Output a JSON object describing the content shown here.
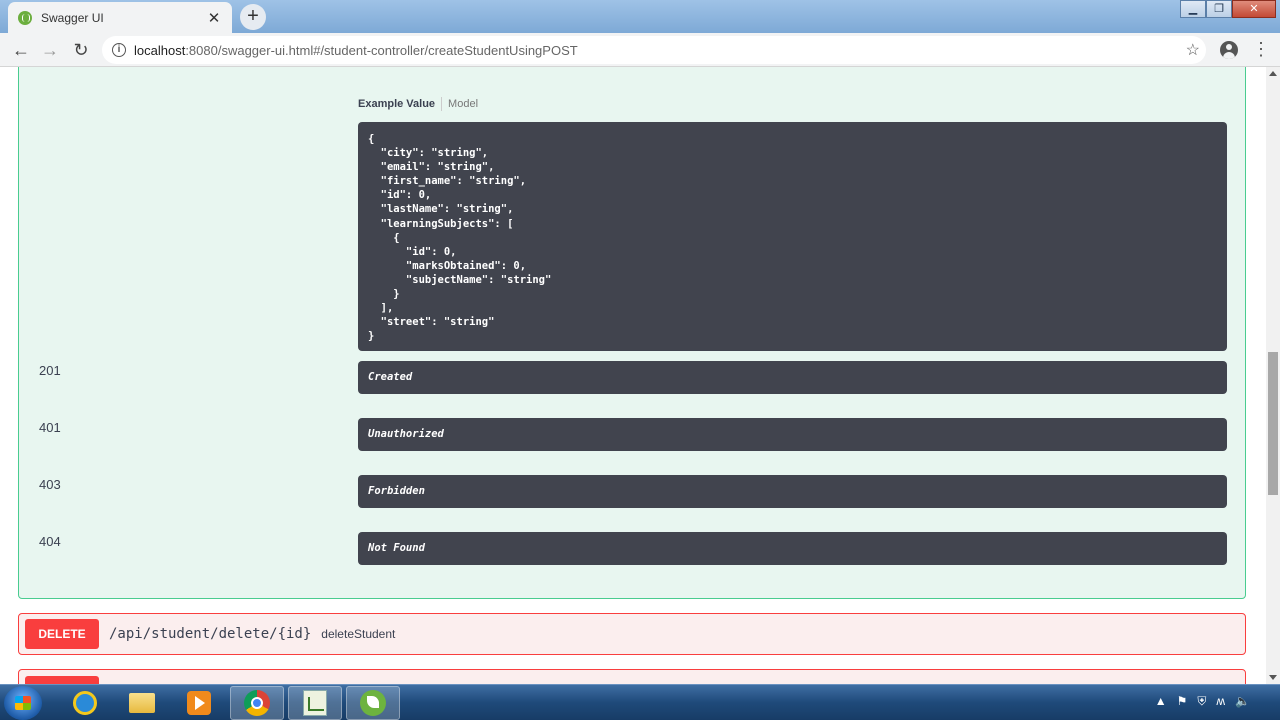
{
  "browser": {
    "tab_title": "Swagger UI",
    "tab_close": "✕",
    "new_tab": "+",
    "url_host": "localhost",
    "url_rest": ":8080/swagger-ui.html#/student-controller/createStudentUsingPOST",
    "nav": {
      "back": "←",
      "forward": "→",
      "reload": "↻",
      "star": "☆",
      "menu": "⋮"
    },
    "window_controls": {
      "minimize": "▁",
      "maximize": "❐",
      "close": "✕"
    }
  },
  "swagger": {
    "example_tab": "Example Value",
    "model_tab": "Model",
    "example_json": "{\n  \"city\": \"string\",\n  \"email\": \"string\",\n  \"first_name\": \"string\",\n  \"id\": 0,\n  \"lastName\": \"string\",\n  \"learningSubjects\": [\n    {\n      \"id\": 0,\n      \"marksObtained\": 0,\n      \"subjectName\": \"string\"\n    }\n  ],\n  \"street\": \"string\"\n}",
    "responses": [
      {
        "code": "201",
        "description": "Created"
      },
      {
        "code": "401",
        "description": "Unauthorized"
      },
      {
        "code": "403",
        "description": "Forbidden"
      },
      {
        "code": "404",
        "description": "Not Found"
      }
    ],
    "delete_operation": {
      "method": "DELETE",
      "path": "/api/student/delete/{id}",
      "summary": "deleteStudent"
    }
  },
  "taskbar": {
    "items": [
      "start-button",
      "internet-explorer",
      "file-explorer",
      "media-player",
      "chrome",
      "chart-app",
      "spring-tool-suite"
    ],
    "tray": [
      "▲",
      "⚑",
      "⛨",
      "ʍ",
      "🔈"
    ]
  },
  "colors": {
    "post_bg": "#e8f6f0",
    "post_border": "#49cc90",
    "delete": "#f93e3e",
    "code_bg": "#41444e"
  }
}
